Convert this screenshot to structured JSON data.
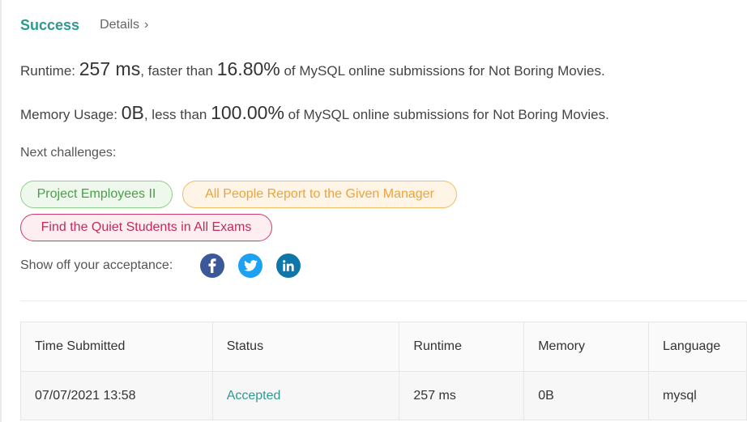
{
  "header": {
    "status": "Success",
    "details": "Details",
    "chevron": "›"
  },
  "runtime": {
    "label": "Runtime:",
    "value": "257 ms",
    "faster_text": ", faster than",
    "percent": "16.80%",
    "suffix": "of MySQL online submissions for Not Boring Movies."
  },
  "memory": {
    "label": "Memory Usage:",
    "value": "0B",
    "less_text": ", less than",
    "percent": "100.00%",
    "suffix": "of MySQL online submissions for Not Boring Movies."
  },
  "next": {
    "label": "Next challenges:",
    "challenges": [
      {
        "title": "Project Employees II",
        "color": "#4a9e4a"
      },
      {
        "title": "All People Report to the Given Manager",
        "color": "#eda33b"
      },
      {
        "title": "Find the Quiet Students in All Exams",
        "color": "#bf2c5b"
      }
    ]
  },
  "share": {
    "label": "Show off your acceptance:",
    "icons": [
      "facebook-icon",
      "twitter-icon",
      "linkedin-icon"
    ]
  },
  "table": {
    "columns": [
      "Time Submitted",
      "Status",
      "Runtime",
      "Memory",
      "Language"
    ],
    "rows": [
      {
        "time": "07/07/2021 13:58",
        "status": "Accepted",
        "runtime": "257 ms",
        "memory": "0B",
        "language": "mysql"
      }
    ]
  },
  "colors": {
    "accent": "#2e9a8f",
    "facebook": "#3b5998",
    "twitter": "#1da1f2",
    "linkedin": "#0e76a8"
  }
}
